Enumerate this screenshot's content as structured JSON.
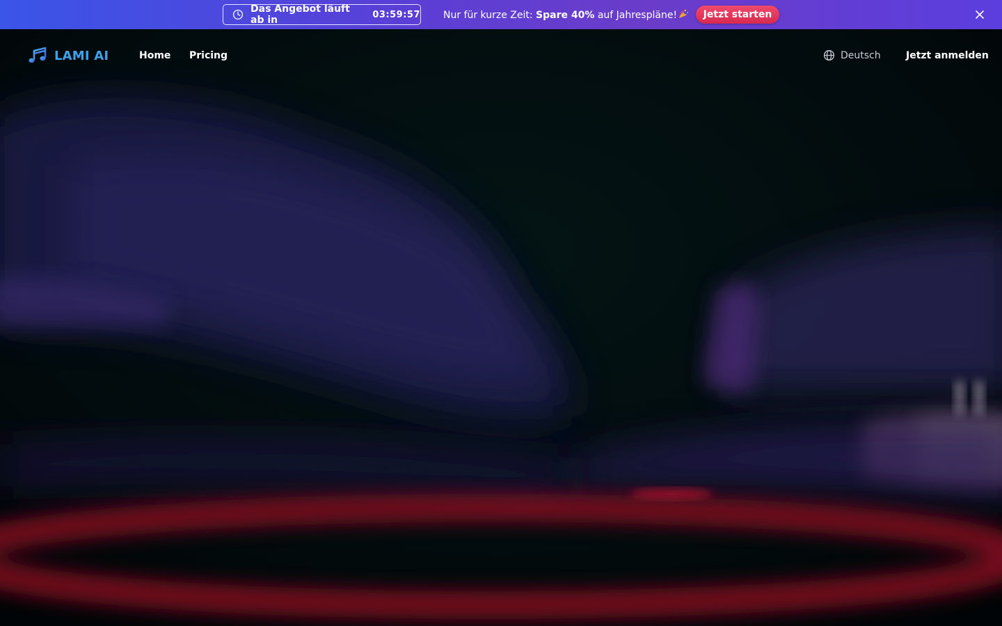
{
  "promo": {
    "countdown_label": "Das Angebot läuft ab in",
    "countdown_time": "03:59:57",
    "offer_prefix": "Nur für kurze Zeit:",
    "offer_highlight": "Spare 40%",
    "offer_suffix": "auf Jahrespläne!",
    "cta_label": "Jetzt starten"
  },
  "nav": {
    "brand": "LAMI AI",
    "links": [
      {
        "label": "Home"
      },
      {
        "label": "Pricing"
      }
    ],
    "language": "Deutsch",
    "login_label": "Jetzt anmelden"
  },
  "colors": {
    "brand": "#3ea2ea",
    "cta": "#e23a5e",
    "banner_start": "#3a55e8",
    "banner_end": "#6b3cc9",
    "background": "#02060a"
  },
  "icons": {
    "countdown": "clock-icon",
    "offer": "party-popper-icon",
    "close": "close-icon",
    "logo": "music-note-icon",
    "language": "globe-icon"
  }
}
